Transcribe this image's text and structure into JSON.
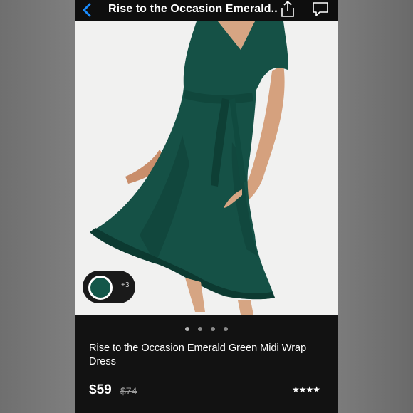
{
  "nav": {
    "title": "Rise to the Occasion Emerald...",
    "back_icon": "chevron-left-icon",
    "share_icon": "share-icon",
    "comment_icon": "comment-icon",
    "accent_color": "#1a8cff"
  },
  "product": {
    "image": "green wrap midi dress photo",
    "swatch_color": "#14574a",
    "more_colors": "+3",
    "name": "Rise to the Occasion Emerald Green Midi Wrap Dress",
    "price": "$59",
    "original_price": "$74",
    "rating_stars": 4
  },
  "carousel": {
    "page_count": 4,
    "active_index": 0
  },
  "stars_text": "★★★★"
}
